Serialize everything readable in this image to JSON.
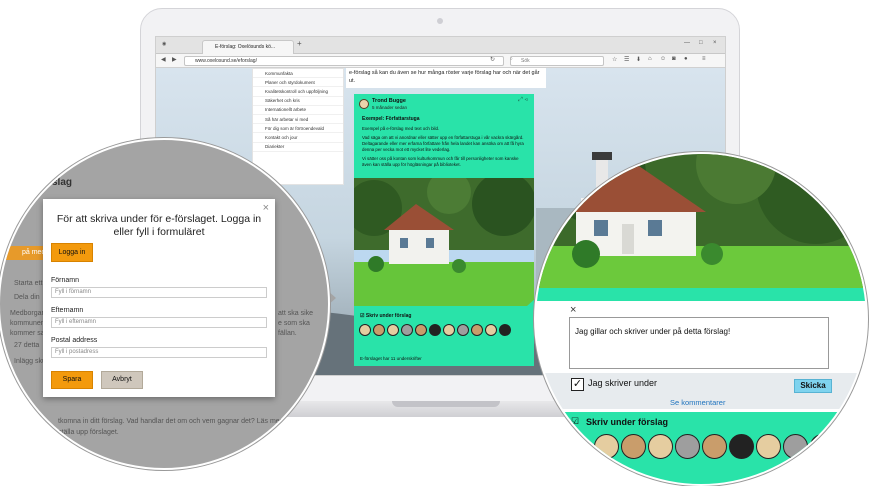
{
  "browser": {
    "tab_title": "E-förslag: Oxelösunds kö...",
    "tab_close": "×",
    "new_tab": "+",
    "window_minimize": "—",
    "window_maximize": "□",
    "window_close": "×",
    "url": "www.oxelosund.se/eforslag/",
    "search_placeholder": "Sök"
  },
  "page": {
    "intro_text": "e-förslag så kan du även se hur många röster varje förslag har och när det går ut.",
    "sidebar_items": [
      "Kommunfakta",
      "Planer och styrdokument",
      "Kvalitetskontroll och uppföljning",
      "Säkerhet och kris",
      "Internationellt arbete",
      "Så här arbetar vi med",
      "För dig som är förtroendevald",
      "Kontakt och jour",
      "Diariekter"
    ]
  },
  "proposal": {
    "author": "Trond Bugge",
    "time": "5 månader sedan",
    "title": "Exempel: Författarstuga",
    "body": [
      "Exempel på e-förslag med text och bild.",
      "Vad säga om att vi anordnar eller sätter upp en författarstuga i vår vackra skärgård. Deltagarande eller mer erfarna författare från hela landet kan ansöka om att få hyra denna per vecka mot ett mycket lite vederlag.",
      "Vi sätter oss på kontan som kulturkommun och får till personligheter som kanske även kan ställa upp för högläsningar på biblioteket."
    ],
    "sign_label": "Skriv under förslag",
    "signature_count": "E-förslaget har 11 underskrifter"
  },
  "background": {
    "heading": "slag",
    "orange_label": "på med n",
    "items": [
      "Starta ett",
      "Dela din",
      "Medborgar",
      "kommunen i",
      "kommer sa",
      "27 detta",
      "Inlägg sku"
    ],
    "right_fragments": [
      "att ska sike",
      "e som ska",
      "fällan."
    ],
    "bottom_text": "tkomna in ditt förslag. Vad handlar det om och vem gagnar det? Läs mer om",
    "bottom_text_2": "ställa upp förslaget."
  },
  "login_modal": {
    "close": "×",
    "title": "För att skriva under för e-förslaget. Logga in eller fyll i formuläret",
    "login_button": "Logga in",
    "first_name_label": "Förnamn",
    "first_name_placeholder": "Fyll i förnamn",
    "last_name_label": "Efternamn",
    "last_name_placeholder": "Fyll i efternamn",
    "postal_label": "Postal address",
    "postal_placeholder": "Fyll i postadress",
    "save_button": "Spara",
    "cancel_button": "Avbryt"
  },
  "comment_panel": {
    "close": "×",
    "comment_text": "Jag gillar och skriver under på detta förslag!",
    "checkbox_label": "Jag skriver under",
    "checkbox_mark": "✓",
    "send_button": "Skicka",
    "see_comments": "Se kommentarer",
    "sign_label": "Skriv under förslag"
  },
  "colors": {
    "accent_green": "#29e3a9",
    "button_orange": "#f39a0d",
    "button_blue": "#7fd3ee",
    "link_blue": "#1e73be"
  }
}
